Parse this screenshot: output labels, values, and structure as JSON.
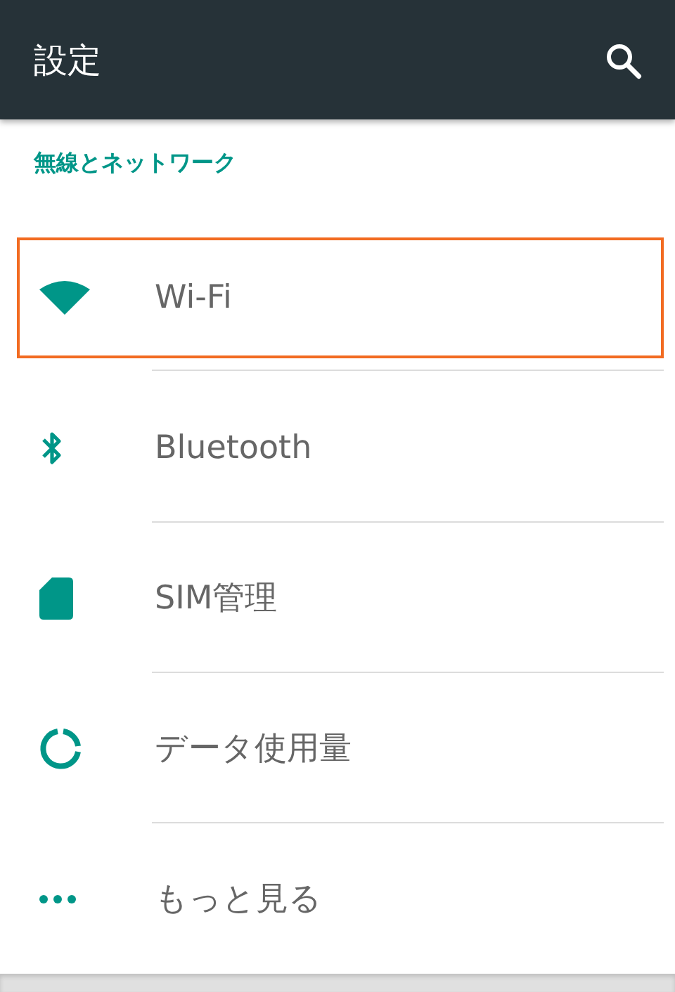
{
  "app_bar": {
    "title": "設定",
    "search": true
  },
  "section": {
    "title": "無線とネットワーク"
  },
  "items": [
    {
      "kind": "wifi",
      "label": "Wi-Fi",
      "highlighted": true
    },
    {
      "kind": "bluetooth",
      "label": "Bluetooth",
      "highlighted": false
    },
    {
      "kind": "sim",
      "label": "SIM管理",
      "highlighted": false
    },
    {
      "kind": "data",
      "label": "データ使用量",
      "highlighted": false
    },
    {
      "kind": "more",
      "label": "もっと見る",
      "highlighted": false
    }
  ]
}
